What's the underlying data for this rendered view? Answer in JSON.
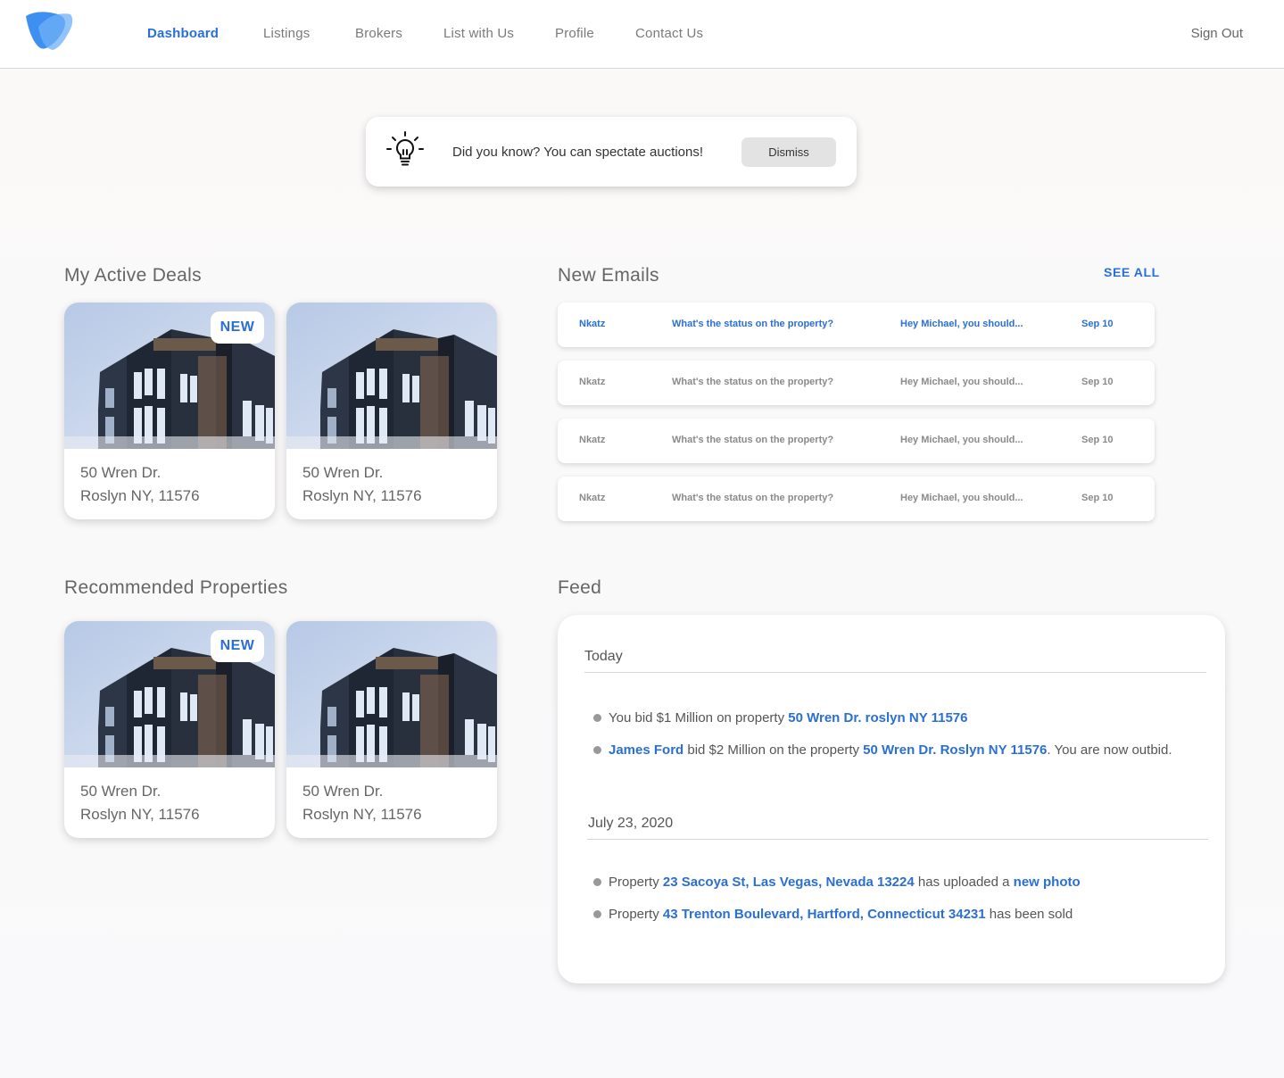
{
  "nav": {
    "items": [
      "Dashboard",
      "Listings",
      "Brokers",
      "List with Us",
      "Profile",
      "Contact Us"
    ],
    "active": "Dashboard",
    "sign_out": "Sign Out"
  },
  "tip": {
    "icon": "lightbulb-icon",
    "text": "Did you know? You can spectate auctions!",
    "dismiss_label": "Dismiss"
  },
  "active_deals": {
    "title": "My Active Deals",
    "cards": [
      {
        "badge": "NEW",
        "line1": "50 Wren Dr.",
        "line2": "Roslyn NY, 11576"
      },
      {
        "badge": "",
        "line1": "50 Wren Dr.",
        "line2": "Roslyn NY, 11576"
      }
    ]
  },
  "recommended": {
    "title": "Recommended Properties",
    "cards": [
      {
        "badge": "NEW",
        "line1": "50 Wren Dr.",
        "line2": "Roslyn NY, 11576"
      },
      {
        "badge": "",
        "line1": "50 Wren Dr.",
        "line2": "Roslyn NY, 11576"
      }
    ]
  },
  "emails": {
    "title": "New Emails",
    "see_all": "SEE ALL",
    "rows": [
      {
        "from": "Nkatz",
        "subject": "What's the status on the property?",
        "preview": "Hey Michael, you should...",
        "date": "Sep 10",
        "unread": true
      },
      {
        "from": "Nkatz",
        "subject": "What's the status on the property?",
        "preview": "Hey Michael, you should...",
        "date": "Sep 10",
        "unread": false
      },
      {
        "from": "Nkatz",
        "subject": "What's the status on the property?",
        "preview": "Hey Michael, you should...",
        "date": "Sep 10",
        "unread": false
      },
      {
        "from": "Nkatz",
        "subject": "What's the status on the property?",
        "preview": "Hey Michael, you should...",
        "date": "Sep 10",
        "unread": false
      }
    ]
  },
  "feed": {
    "title": "Feed",
    "groups": [
      {
        "date": "Today",
        "items": [
          {
            "pre": "You bid $1 Million on property ",
            "link": "50 Wren Dr. roslyn NY 11576",
            "post": ""
          },
          {
            "link0": "James Ford",
            "pre": " bid $2 Million on the property ",
            "link": "50 Wren Dr. Roslyn NY 11576",
            "post": ". You are now outbid."
          }
        ]
      },
      {
        "date": "July 23, 2020",
        "items": [
          {
            "pre": "Property ",
            "link": "23 Sacoya St, Las Vegas, Nevada 13224",
            "post": " has uploaded a ",
            "link2": "new photo"
          },
          {
            "pre": "Property ",
            "link": "43 Trenton Boulevard, Hartford, Connecticut 34231",
            "post": " has been sold"
          }
        ]
      }
    ]
  },
  "colors": {
    "accent": "#2a6fd6",
    "muted": "#8a8a8a"
  }
}
